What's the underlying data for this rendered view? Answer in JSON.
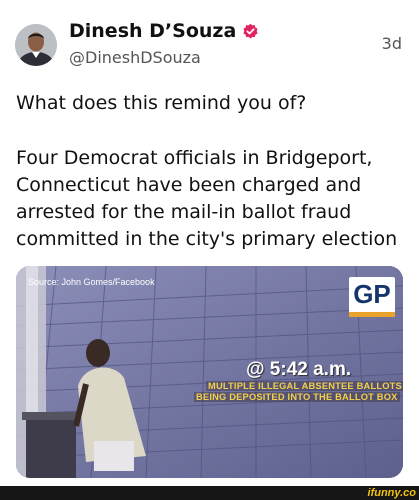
{
  "post": {
    "author_name": "Dinesh D’Souza",
    "handle": "@DineshDSouza",
    "time": "3d",
    "text_1": "What does this remind you of?",
    "text_2": "Four Democrat officials in Bridgeport, Connecticut have been charged and arrested for the mail-in ballot fraud committed in the city's primary election"
  },
  "media": {
    "source": "Source: John Gomes/Facebook",
    "logo": "GP",
    "caption_time": "@ 5:42 a.m.",
    "caption_line_1": "MULTIPLE ILLEGAL ABSENTEE BALLOTS",
    "caption_line_2": "BEING DEPOSITED INTO THE BALLOT BOX"
  },
  "footer": {
    "watermark": "ifunny.co"
  },
  "colors": {
    "verified_badge": "#e0245e",
    "logo_text": "#16366b",
    "logo_bar": "#e8a32a",
    "caption_yellow": "#f2d04a",
    "watermark": "#f1c40f"
  },
  "icons": {
    "verified": "verified-badge-icon",
    "avatar": "avatar-image"
  }
}
